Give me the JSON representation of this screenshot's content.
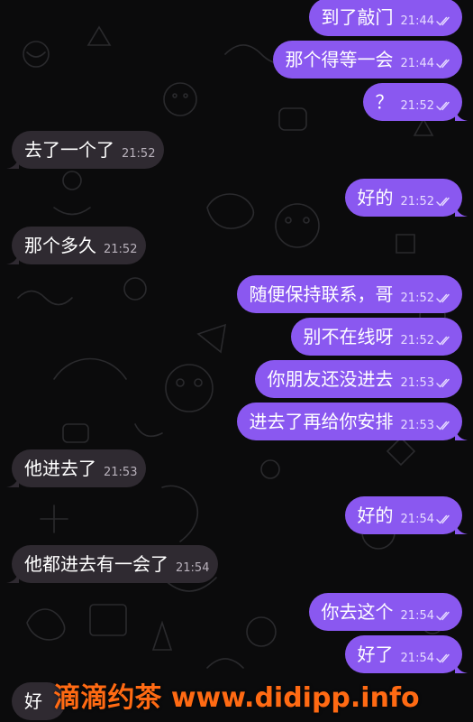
{
  "colors": {
    "outgoing_bubble": "#8a58f0",
    "incoming_bubble": "#2f2a31",
    "background": "#0b0b0c",
    "watermark": "#ff6a13"
  },
  "messages": [
    {
      "dir": "out",
      "text": "到了敲门",
      "time": "21:44",
      "read": true
    },
    {
      "dir": "out",
      "text": "那个得等一会",
      "time": "21:44",
      "read": true
    },
    {
      "dir": "out",
      "text": "？",
      "time": "21:52",
      "read": true
    },
    {
      "dir": "in",
      "text": "去了一个了",
      "time": "21:52"
    },
    {
      "dir": "out",
      "text": "好的",
      "time": "21:52",
      "read": true
    },
    {
      "dir": "in",
      "text": "那个多久",
      "time": "21:52"
    },
    {
      "dir": "out",
      "text": "随便保持联系，哥",
      "time": "21:52",
      "read": true
    },
    {
      "dir": "out",
      "text": "别不在线呀",
      "time": "21:52",
      "read": true
    },
    {
      "dir": "out",
      "text": "你朋友还没进去",
      "time": "21:53",
      "read": true
    },
    {
      "dir": "out",
      "text": "进去了再给你安排",
      "time": "21:53",
      "read": true
    },
    {
      "dir": "in",
      "text": "他进去了",
      "time": "21:53"
    },
    {
      "dir": "out",
      "text": "好的",
      "time": "21:54",
      "read": true
    },
    {
      "dir": "in",
      "text": "他都进去有一会了",
      "time": "21:54"
    },
    {
      "dir": "out",
      "text": "你去这个",
      "time": "21:54",
      "read": true
    },
    {
      "dir": "out",
      "text": "好了",
      "time": "21:54",
      "read": true
    },
    {
      "dir": "in",
      "text": "好",
      "time": ""
    }
  ],
  "watermark": "滴滴约茶 www.didipp.info"
}
